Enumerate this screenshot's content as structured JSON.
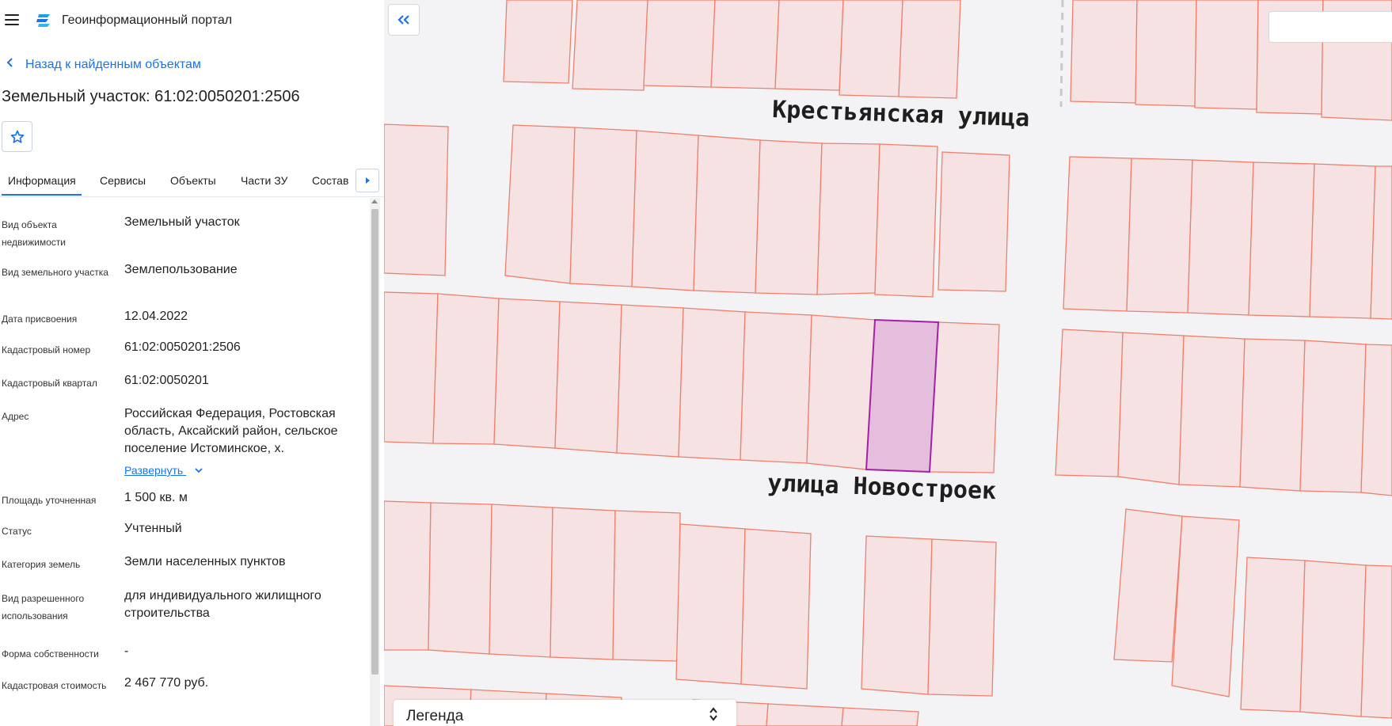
{
  "app": {
    "title": "Геоинформационный портал"
  },
  "nav": {
    "back_label": "Назад к найденным объектам"
  },
  "object": {
    "title": "Земельный участок: 61:02:0050201:2506"
  },
  "tabs": [
    {
      "label": "Информация",
      "active": true
    },
    {
      "label": "Сервисы"
    },
    {
      "label": "Объекты"
    },
    {
      "label": "Части ЗУ"
    },
    {
      "label": "Состав"
    }
  ],
  "attributes": [
    {
      "label": "Вид объекта недвижимости",
      "value": "Земельный участок"
    },
    {
      "label": "Вид земельного участка",
      "value": "Землепользование"
    },
    {
      "label": "Дата присвоения",
      "value": "12.04.2022"
    },
    {
      "label": "Кадастровый номер",
      "value": "61:02:0050201:2506"
    },
    {
      "label": "Кадастровый квартал",
      "value": "61:02:0050201"
    },
    {
      "label": "Адрес",
      "value": "Российская Федерация, Ростовская область, Аксайский район, сельское поселение Истоминское, х.",
      "expand_label": "Развернуть"
    },
    {
      "label": "Площадь уточненная",
      "value": "1 500 кв. м"
    },
    {
      "label": "Статус",
      "value": "Учтенный"
    },
    {
      "label": "Категория земель",
      "value": "Земли населенных пунктов"
    },
    {
      "label": "Вид разрешенного использования",
      "value": "для индивидуального жилищного строительства"
    },
    {
      "label": "Форма собственности",
      "value": "-"
    },
    {
      "label": "Кадастровая стоимость",
      "value": "2 467 770 руб."
    }
  ],
  "map": {
    "street_top": "Крестьянская улица",
    "street_bottom": "улица Новостроек",
    "search": {
      "value": "",
      "placeholder": ""
    },
    "legend_title": "Легенда",
    "parcel_fill": "#f6e2e2",
    "parcel_stroke": "#ef7f6a",
    "selected_fill": "#e6bedd",
    "selected_stroke": "#a321a6"
  },
  "icons": {
    "menu": "hamburger-icon",
    "logo": "layers-logo-icon",
    "back": "chevron-left-icon",
    "favorite": "star-outline-icon",
    "tab_scroll": "caret-right-icon",
    "collapse": "double-chevron-left-icon",
    "expand": "chevron-down-icon",
    "legend_toggle": "up-down-arrows-icon"
  }
}
